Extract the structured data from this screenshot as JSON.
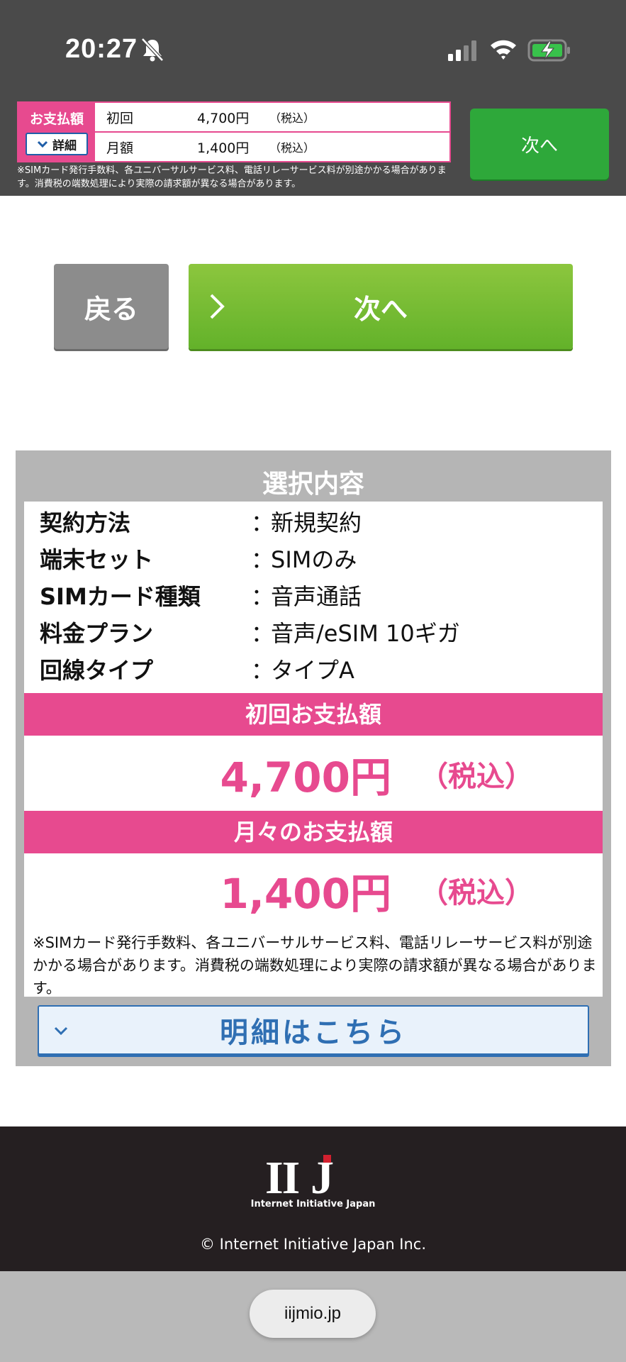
{
  "status_bar": {
    "time": "20:27"
  },
  "sticky": {
    "pay_label": "お支払額",
    "detail_label": "詳細",
    "rows": [
      {
        "key": "初回",
        "value": "4,700円",
        "tax": "（税込）"
      },
      {
        "key": "月額",
        "value": "1,400円",
        "tax": "（税込）"
      }
    ],
    "note": "※SIMカード発行手数料、各ユニバーサルサービス料、電話リレーサービス料が別途かかる場合があります。消費税の端数処理により実際の請求額が異なる場合があります。",
    "next_label": "次へ"
  },
  "nav": {
    "back_label": "戻る",
    "next_label": "次へ"
  },
  "summary": {
    "title": "選択内容",
    "items": [
      {
        "label": "契約方法",
        "sep": "：",
        "value": "新規契約"
      },
      {
        "label": "端末セット",
        "sep": "：",
        "value": "SIMのみ"
      },
      {
        "label": "SIMカード種類",
        "sep": "：",
        "value": "音声通話"
      },
      {
        "label": "料金プラン",
        "sep": "：",
        "value": "音声/eSIM 10ギガ"
      },
      {
        "label": "回線タイプ",
        "sep": "：",
        "value": "タイプA"
      }
    ],
    "initial_heading": "初回お支払額",
    "initial_amount": "4,700円",
    "initial_tax": "（税込）",
    "monthly_heading": "月々のお支払額",
    "monthly_amount": "1,400円",
    "monthly_tax": "（税込）",
    "note": "※SIMカード発行手数料、各ユニバーサルサービス料、電話リレーサービス料が別途かかる場合があります。消費税の端数処理により実際の請求額が異なる場合があります。",
    "detail_link": "明細はこちら"
  },
  "footer": {
    "logo_text": "IIJ",
    "logo_sub": "Internet Initiative Japan",
    "copyright": "© Internet Initiative Japan Inc."
  },
  "browser": {
    "url": "iijmio.jp"
  },
  "colors": {
    "pink": "#e74a8f",
    "green": "#2ea83a",
    "next_green": "#7cbd35",
    "blue": "#2f6fb3",
    "footer_bg": "#251f21",
    "logo_red": "#d2202f"
  }
}
